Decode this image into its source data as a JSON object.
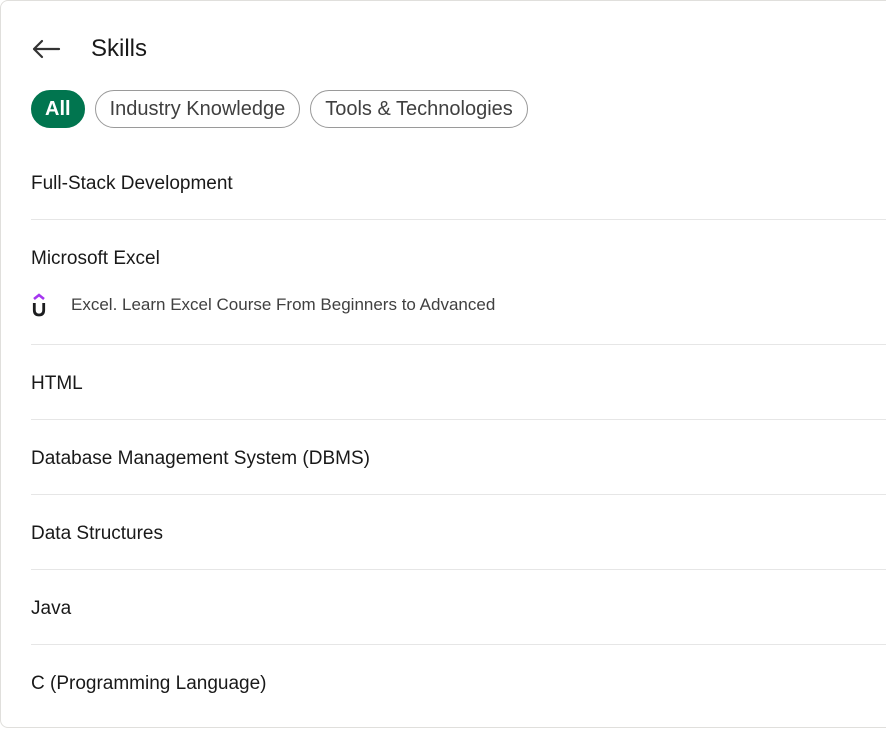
{
  "header": {
    "title": "Skills",
    "back_icon": "arrow-left-icon"
  },
  "filters": [
    {
      "label": "All",
      "active": true
    },
    {
      "label": "Industry Knowledge",
      "active": false
    },
    {
      "label": "Tools & Technologies",
      "active": false
    }
  ],
  "skills": [
    {
      "name": "Full-Stack Development"
    },
    {
      "name": "Microsoft Excel",
      "source": {
        "icon": "udemy-logo-icon",
        "text": "Excel. Learn Excel Course From Beginners to Advanced"
      }
    },
    {
      "name": "HTML"
    },
    {
      "name": "Database Management System (DBMS)"
    },
    {
      "name": "Data Structures"
    },
    {
      "name": "Java"
    },
    {
      "name": "C (Programming Language)"
    }
  ],
  "colors": {
    "accent": "#01754f",
    "udemy": "#a435f0"
  }
}
